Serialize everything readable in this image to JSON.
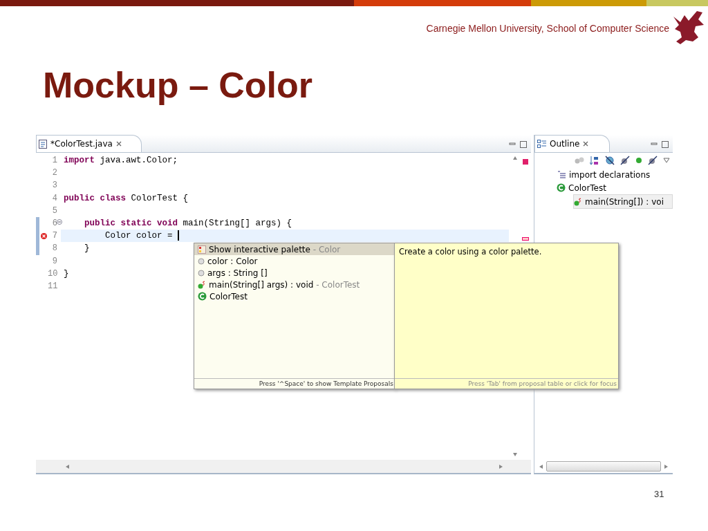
{
  "slide": {
    "header": "Carnegie Mellon University, School of Computer Science",
    "title": "Mockup – Color",
    "page_number": "31"
  },
  "editor": {
    "tab": {
      "title": "*ColorTest.java",
      "selected": true
    },
    "lines": [
      {
        "number": "1",
        "current": false,
        "error": false,
        "folding": false,
        "changed": false,
        "tokens": [
          {
            "kind": "keyword",
            "text": "import"
          },
          {
            "kind": "plain",
            "text": " java.awt.Color;"
          }
        ]
      },
      {
        "number": "2",
        "current": false,
        "error": false,
        "folding": false,
        "changed": false
      },
      {
        "number": "3",
        "current": false,
        "error": false,
        "folding": false,
        "changed": false
      },
      {
        "number": "4",
        "current": false,
        "error": false,
        "folding": false,
        "changed": false,
        "tokens": [
          {
            "kind": "keyword",
            "text": "public class"
          },
          {
            "kind": "plain",
            "text": " ColorTest {"
          }
        ]
      },
      {
        "number": "5",
        "current": false,
        "error": false,
        "folding": false,
        "changed": false
      },
      {
        "number": "6",
        "current": false,
        "error": false,
        "folding": true,
        "changed": true,
        "tokens": [
          {
            "kind": "keyword",
            "text": "    public static void"
          },
          {
            "kind": "plain",
            "text": " main(String[] args) {"
          }
        ]
      },
      {
        "number": "7",
        "current": true,
        "error": true,
        "folding": false,
        "changed": true,
        "tokens": [
          {
            "kind": "plain",
            "text": "        Color color = "
          }
        ]
      },
      {
        "number": "8",
        "current": false,
        "error": false,
        "folding": false,
        "changed": true,
        "tokens": [
          {
            "kind": "plain",
            "text": "    }"
          }
        ]
      },
      {
        "number": "9",
        "current": false,
        "error": false,
        "folding": false,
        "changed": false
      },
      {
        "number": "10",
        "current": false,
        "error": false,
        "folding": false,
        "changed": false,
        "tokens": [
          {
            "kind": "plain",
            "text": "}"
          }
        ]
      },
      {
        "number": "11",
        "current": false,
        "error": false,
        "folding": false,
        "changed": false
      }
    ]
  },
  "content_assist": {
    "proposals": [
      {
        "kind": "palette",
        "label": "Show interactive palette",
        "qualifier": "- Color",
        "selected": true
      },
      {
        "kind": "field",
        "label": "color : Color",
        "selected": false
      },
      {
        "kind": "field",
        "label": "args : String []",
        "selected": false
      },
      {
        "kind": "method",
        "label": "main(String[] args) : void",
        "qualifier": "- ColorTest",
        "selected": false
      },
      {
        "kind": "class",
        "label": "ColorTest",
        "selected": false
      }
    ],
    "footer": "Press '^Space' to show Template Proposals",
    "info": {
      "text": "Create a color using a color palette.",
      "footer": "Press 'Tab' from proposal table or click for focus"
    }
  },
  "outline": {
    "title": "Outline",
    "items": [
      {
        "kind": "imports",
        "label": "import declarations",
        "selected": false
      },
      {
        "kind": "class",
        "label": "ColorTest",
        "selected": false,
        "children": [
          {
            "kind": "method",
            "label": "main(String[]) : voi",
            "selected": true
          }
        ]
      }
    ]
  }
}
